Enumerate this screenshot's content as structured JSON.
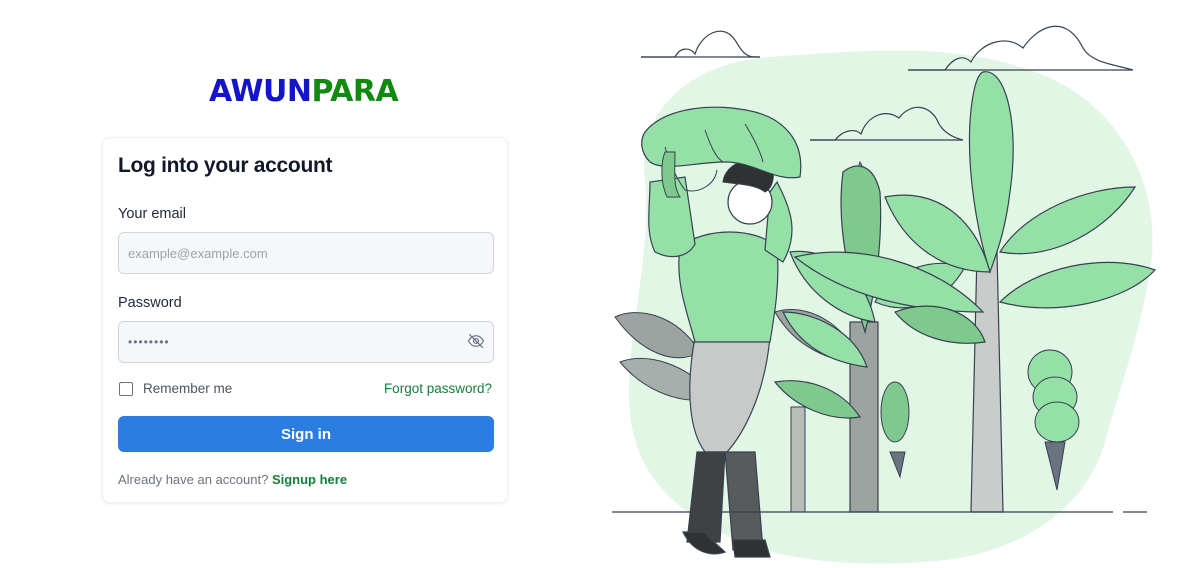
{
  "brand": {
    "part1": "AWUN",
    "part2": "PARA",
    "color1": "#1414c8",
    "color2": "#128a12"
  },
  "login": {
    "title": "Log into your account",
    "email_label": "Your email",
    "email_placeholder": "example@example.com",
    "password_label": "Password",
    "password_mask": "••••••••",
    "password_toggle_icon": "eye-slash-icon",
    "remember_label": "Remember me",
    "remember_checked": false,
    "forgot_link": "Forgot password?",
    "submit_label": "Sign in",
    "footer_text": "Already have an account?",
    "signup_link": "Signup here"
  },
  "colors": {
    "primary_button": "#2b7de0",
    "link_green": "#15803d",
    "illustration_green": "#94e0a6"
  }
}
